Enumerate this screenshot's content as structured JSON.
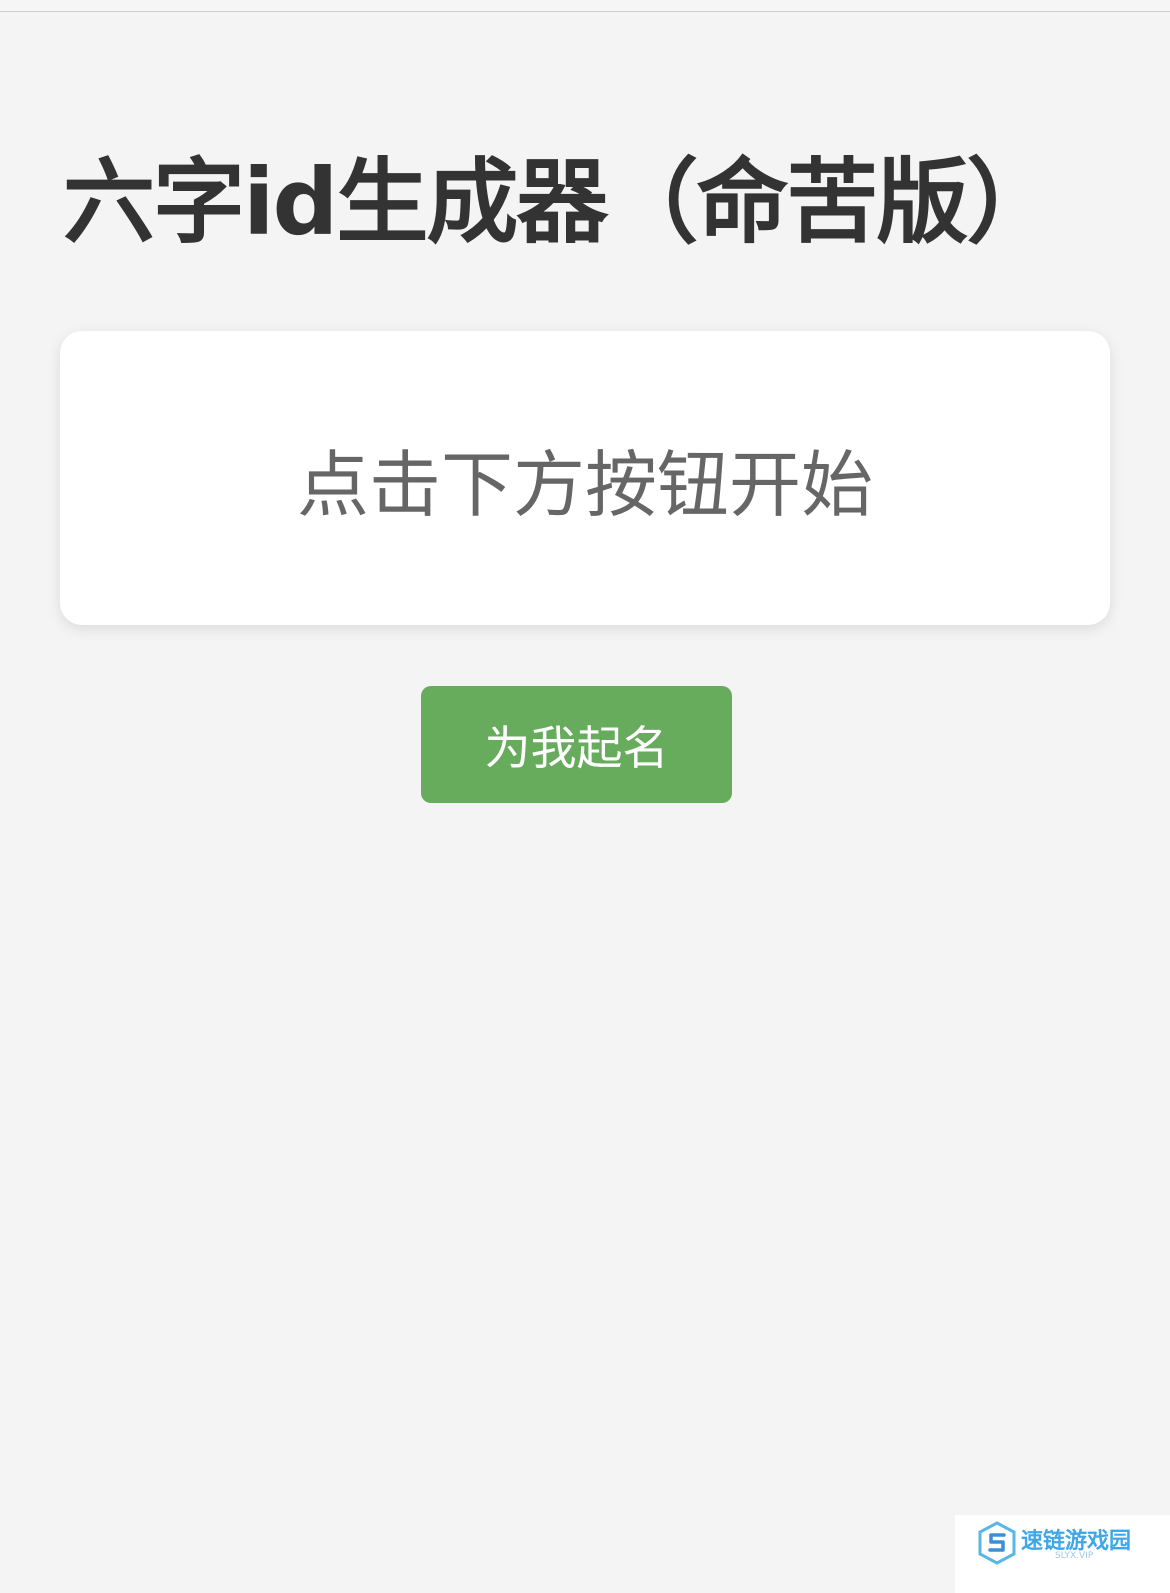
{
  "page": {
    "title": "六字id生成器（命苦版）"
  },
  "result": {
    "placeholder_text": "点击下方按钮开始"
  },
  "actions": {
    "generate_label": "为我起名"
  },
  "watermark": {
    "brand": "速链游戏园",
    "sub": "SLYX.VIP"
  },
  "colors": {
    "background": "#f4f4f4",
    "card": "#ffffff",
    "button": "#67ab5c",
    "title": "#333333",
    "result_text": "#666666"
  }
}
